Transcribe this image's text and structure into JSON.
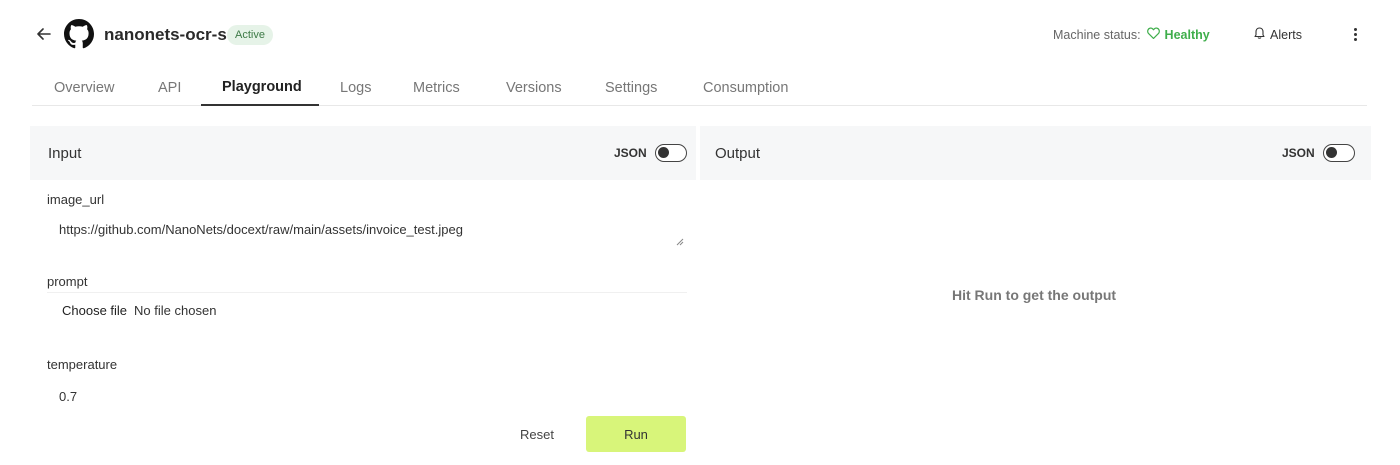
{
  "header": {
    "model_name": "nanonets-ocr-s",
    "status_badge": "Active",
    "machine_status_label": "Machine status:",
    "machine_status_value": "Healthy",
    "alerts_label": "Alerts",
    "healthy_color": "#3fae4b",
    "icons": [
      "back-arrow-icon",
      "github-icon",
      "heart-icon",
      "bell-icon",
      "more-vertical-icon"
    ]
  },
  "tabs": [
    {
      "label": "Overview"
    },
    {
      "label": "API"
    },
    {
      "label": "Playground",
      "active": true
    },
    {
      "label": "Logs"
    },
    {
      "label": "Metrics"
    },
    {
      "label": "Versions"
    },
    {
      "label": "Settings"
    },
    {
      "label": "Consumption"
    }
  ],
  "input_panel": {
    "title": "Input",
    "json_label": "JSON",
    "json_toggle_on": false,
    "fields": {
      "image_url_label": "image_url",
      "image_url_value": "https://github.com/NanoNets/docext/raw/main/assets/invoice_test.jpeg",
      "prompt_label": "prompt",
      "choose_file_label": "Choose file",
      "no_file_text": "No file chosen",
      "temperature_label": "temperature",
      "temperature_value": "0.7"
    },
    "reset_label": "Reset",
    "run_label": "Run",
    "run_color": "#d8f57a"
  },
  "output_panel": {
    "title": "Output",
    "json_label": "JSON",
    "json_toggle_on": false,
    "placeholder": "Hit Run to get the output"
  }
}
